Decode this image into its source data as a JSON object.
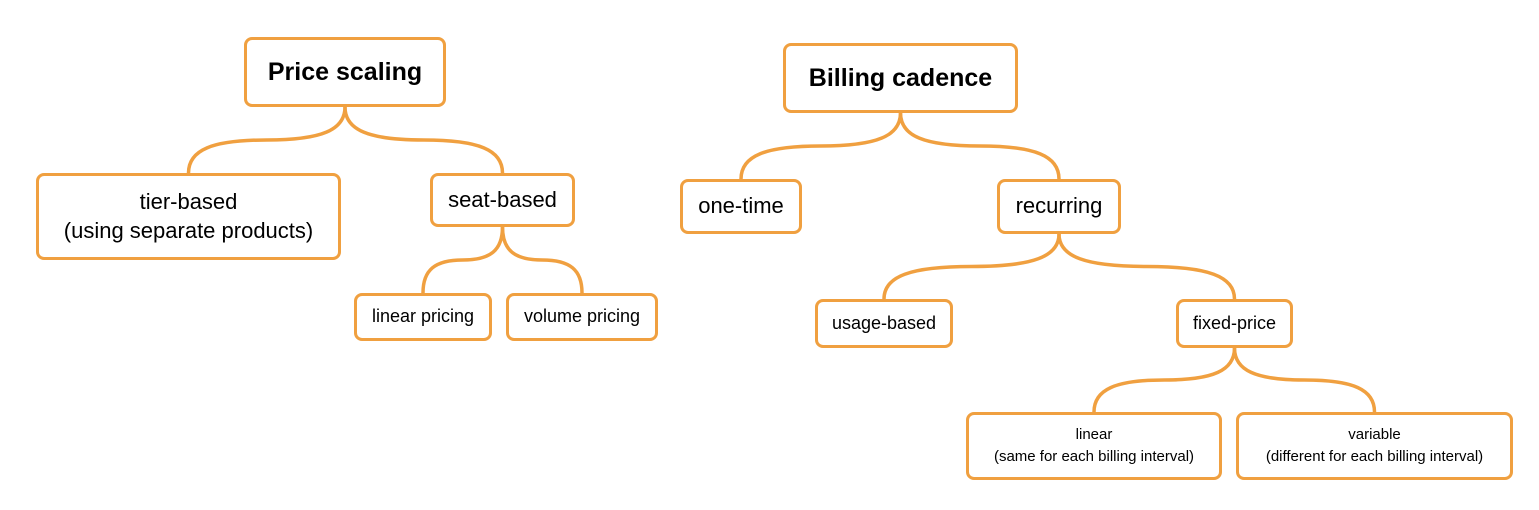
{
  "style": {
    "accent_color": "#F0A040"
  },
  "trees": [
    {
      "root": "Price scaling",
      "children": [
        {
          "lines": [
            "tier-based",
            "(using separate products)"
          ]
        },
        {
          "lines": [
            "seat-based"
          ],
          "children": [
            {
              "lines": [
                "linear pricing"
              ]
            },
            {
              "lines": [
                "volume pricing"
              ]
            }
          ]
        }
      ]
    },
    {
      "root": "Billing cadence",
      "children": [
        {
          "lines": [
            "one-time"
          ]
        },
        {
          "lines": [
            "recurring"
          ],
          "children": [
            {
              "lines": [
                "usage-based"
              ]
            },
            {
              "lines": [
                "fixed-price"
              ],
              "children": [
                {
                  "lines": [
                    "linear",
                    "(same for each billing interval)"
                  ]
                },
                {
                  "lines": [
                    "variable",
                    "(different for each billing interval)"
                  ]
                }
              ]
            }
          ]
        }
      ]
    }
  ]
}
